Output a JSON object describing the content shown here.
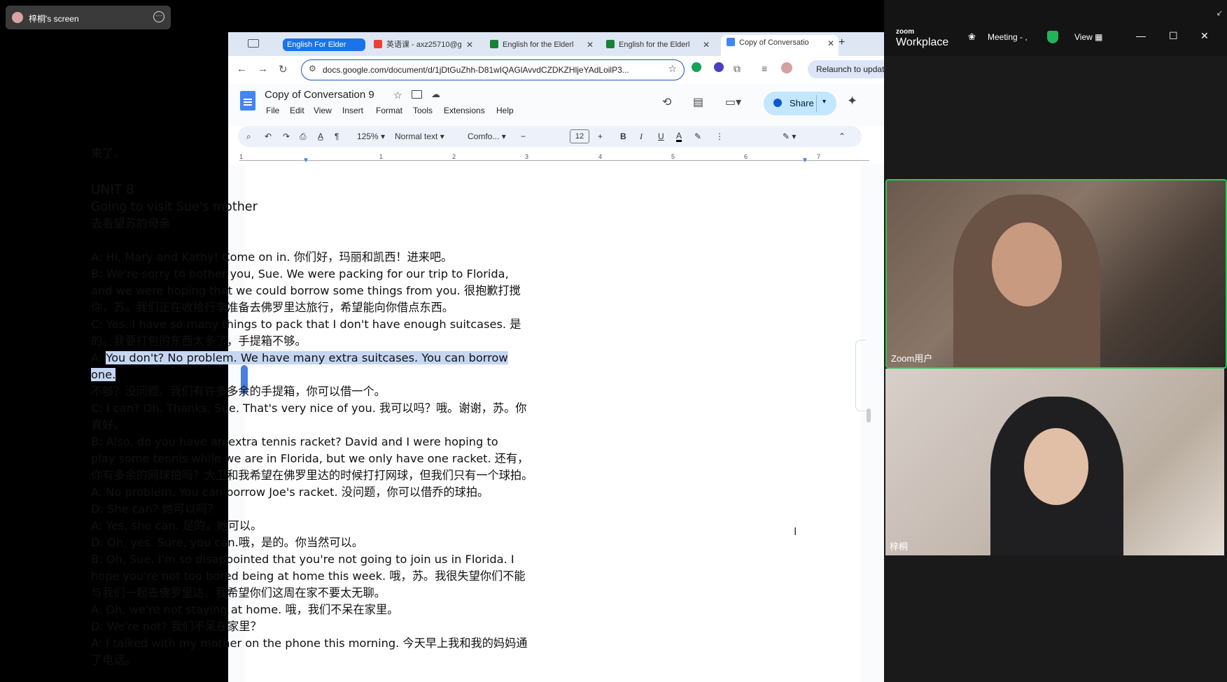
{
  "screen_share": {
    "label": "梓桐's screen",
    "more_icon": "more-icon"
  },
  "browser": {
    "tabs": [
      {
        "label": "English For Elder",
        "icon": "tab-group-icon"
      },
      {
        "label": "英语课 - axz25710@g",
        "icon": "gmail-icon"
      },
      {
        "label": "English for the Elderl",
        "icon": "sheets-icon"
      },
      {
        "label": "English for the Elderl",
        "icon": "sheets-icon"
      },
      {
        "label": "Copy of Conversatio",
        "icon": "docs-icon"
      }
    ],
    "url": "docs.google.com/document/d/1jDtGuZhh-D81wIQAGlAvvdCZDKZHljeYAdLoilP3...",
    "relaunch": "Relaunch to updat"
  },
  "docs": {
    "title": "Copy of Conversation 9",
    "menu": [
      "File",
      "Edit",
      "View",
      "Insert",
      "Format",
      "Tools",
      "Extensions",
      "Help"
    ],
    "share_label": "Share",
    "toolbar": {
      "zoom": "125%",
      "style": "Normal text",
      "font": "Comfo...",
      "font_size": "12",
      "bold": "B",
      "italic": "I",
      "underline": "U",
      "text_color": "A"
    },
    "ruler": [
      "1",
      "1",
      "2",
      "3",
      "4",
      "5",
      "6",
      "7"
    ],
    "lines": [
      "来了。",
      "UNIT 8",
      "Going to visit Sue's mother",
      "去看望苏的母亲",
      "A: Hi, Mary and Kathy! Come on in. 你们好，玛丽和凯西！进来吧。",
      "B: We're sorry to bother you, Sue. We were packing for our trip to Florida,",
      "and we were hoping that we could borrow some things from you. 很抱歉打搅",
      "你，苏。我们正在收拾行李准备去佛罗里达旅行，希望能向你借点东西。",
      "C: Yes. I have so many things to pack that I don't have enough suitcases. 是",
      "的。我要打包的东西太多了，手提箱不够。",
      "A: ",
      "You don't? No problem. We have many extra suitcases. You can borrow",
      "one.",
      "不够？没问题。我们有许多多余的手提箱，你可以借一个。",
      "C: I can? Oh. Thanks, Sue. That's very nice of you. 我可以吗？哦。谢谢，苏。你",
      "真好。",
      "B: Also, do you have an extra tennis racket? David and I were hoping to",
      "play some tennis while we are in Florida, but we only have one racket. 还有，",
      "你有多余的网球拍吗？大卫和我希望在佛罗里达的时候打打网球，但我们只有一个球拍。",
      "A: No problem. You can borrow Joe's racket. 没问题，你可以借乔的球拍。",
      "D: She can? 她可以吗？",
      "A: Yes, she can. 是的，她可以。",
      "D: Oh, yes. Sure, you can.哦，是的。你当然可以。",
      "B: Oh, Sue. I'm so disappointed that you're not going to join us in Florida. I",
      "hope you're not too bored being at home this week. 哦，苏。我很失望你们不能",
      "与我们一起去佛罗里达。我希望你们这周在家不要太无聊。",
      "A: Oh, we're not staying at home. 哦，我们不呆在家里。",
      "D: We're not? 我们不呆在家里？",
      "A: I talked with my mother on the phone this morning. 今天早上我和我的妈妈通",
      "了电话。"
    ]
  },
  "zoom": {
    "brand_small": "zoom",
    "brand": "Workplace",
    "meeting": "Meeting - ,",
    "view": "View",
    "participants": [
      "Zoom用户",
      "梓桐"
    ],
    "accent": "#34c45a"
  }
}
